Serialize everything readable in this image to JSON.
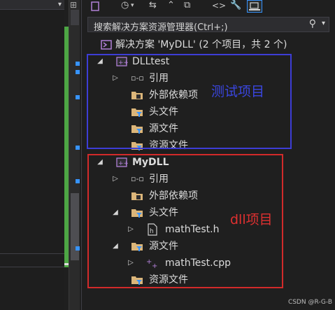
{
  "search": {
    "placeholder": "搜索解决方案资源管理器(Ctrl+;)"
  },
  "solution": {
    "label": "解决方案 'MyDLL' (2 个项目，共 2 个)"
  },
  "projects": [
    {
      "name": "DLLtest",
      "items": {
        "references": "引用",
        "external": "外部依赖项",
        "headers": "头文件",
        "sources": "源文件",
        "resources": "资源文件"
      }
    },
    {
      "name": "MyDLL",
      "items": {
        "references": "引用",
        "external": "外部依赖项",
        "headers": "头文件",
        "header_file": "mathTest.h",
        "sources": "源文件",
        "source_file": "mathTest.cpp",
        "resources": "资源文件"
      }
    }
  ],
  "annotations": {
    "test_project": "测试项目",
    "dll_project": "dll项目"
  },
  "watermark": "CSDN @R-G-B",
  "colors": {
    "accent": "#3794ff",
    "annotation_blue": "#3d3dd6",
    "annotation_red": "#d22a2a",
    "green_margin": "#4da644"
  }
}
